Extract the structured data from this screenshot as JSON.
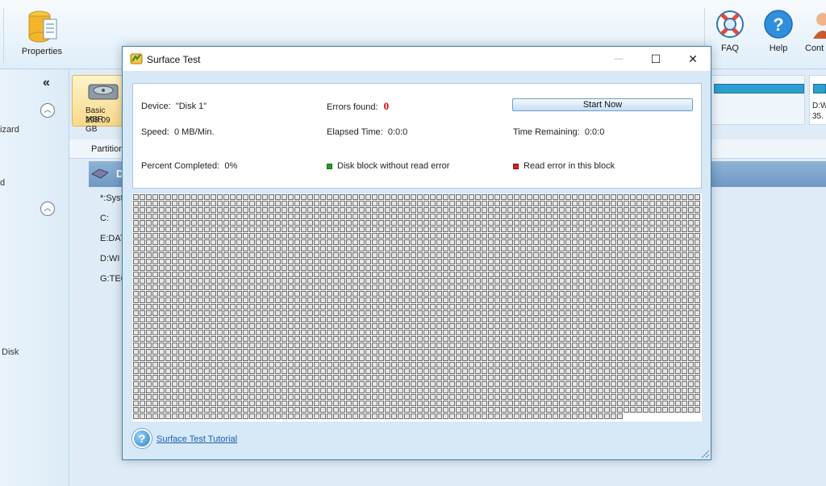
{
  "background_app": {
    "toolbar": {
      "properties_label": "Properties",
      "faq_label": "FAQ",
      "help_label": "Help",
      "contact_label": "Cont"
    },
    "left_panel": {
      "collapse_glyph": "«",
      "items": [
        "izard",
        "d",
        "Disk"
      ]
    },
    "disk_card": {
      "line1": "Basic MBR",
      "line2": "298.09 GB"
    },
    "disk_strip2": {
      "line1": "D:W",
      "line2": "35."
    },
    "partition_header": "Partition",
    "selected_row_label": "D",
    "partition_rows": [
      "*:Syst",
      "C:",
      "E:DAT",
      "D:WI",
      "G:TEC"
    ]
  },
  "dialog": {
    "title": "Surface Test",
    "window_buttons": {
      "minimize": "—",
      "maximize": "☐",
      "close": "✕"
    },
    "device_label": "Device:",
    "device_value": "\"Disk 1\"",
    "errors_label": "Errors found:",
    "errors_value": "0",
    "start_button": "Start Now",
    "speed_label": "Speed:",
    "speed_value": "0 MB/Min.",
    "elapsed_label": "Elapsed Time:",
    "elapsed_value": "0:0:0",
    "remaining_label": "Time Remaining:",
    "remaining_value": "0:0:0",
    "percent_label": "Percent Completed:",
    "percent_value": "0%",
    "legend_ok": "Disk block without read error",
    "legend_error": "Read error in this block",
    "tutorial_link": "Surface Test Tutorial",
    "help_glyph": "?"
  },
  "colors": {
    "accent": "#3c7fb1",
    "errors_value": "#e00000",
    "legend_ok": "#1aa21a",
    "legend_error": "#d81e1e",
    "block_border": "#6b6b6b",
    "block_fill": "#e6e6e6"
  },
  "icons": {
    "title_icon": "surface-test-icon",
    "properties_icon": "properties-icon",
    "faq_icon": "lifebuoy-icon",
    "help_icon": "question-icon",
    "contact_icon": "contact-icon",
    "disk_icon": "hard-disk-icon",
    "tutorial_icon": "help-circle-icon"
  },
  "surface_grid": {
    "columns": 88,
    "rows": 35,
    "filled_blocks_last_row": 76,
    "status": "unscanned"
  }
}
